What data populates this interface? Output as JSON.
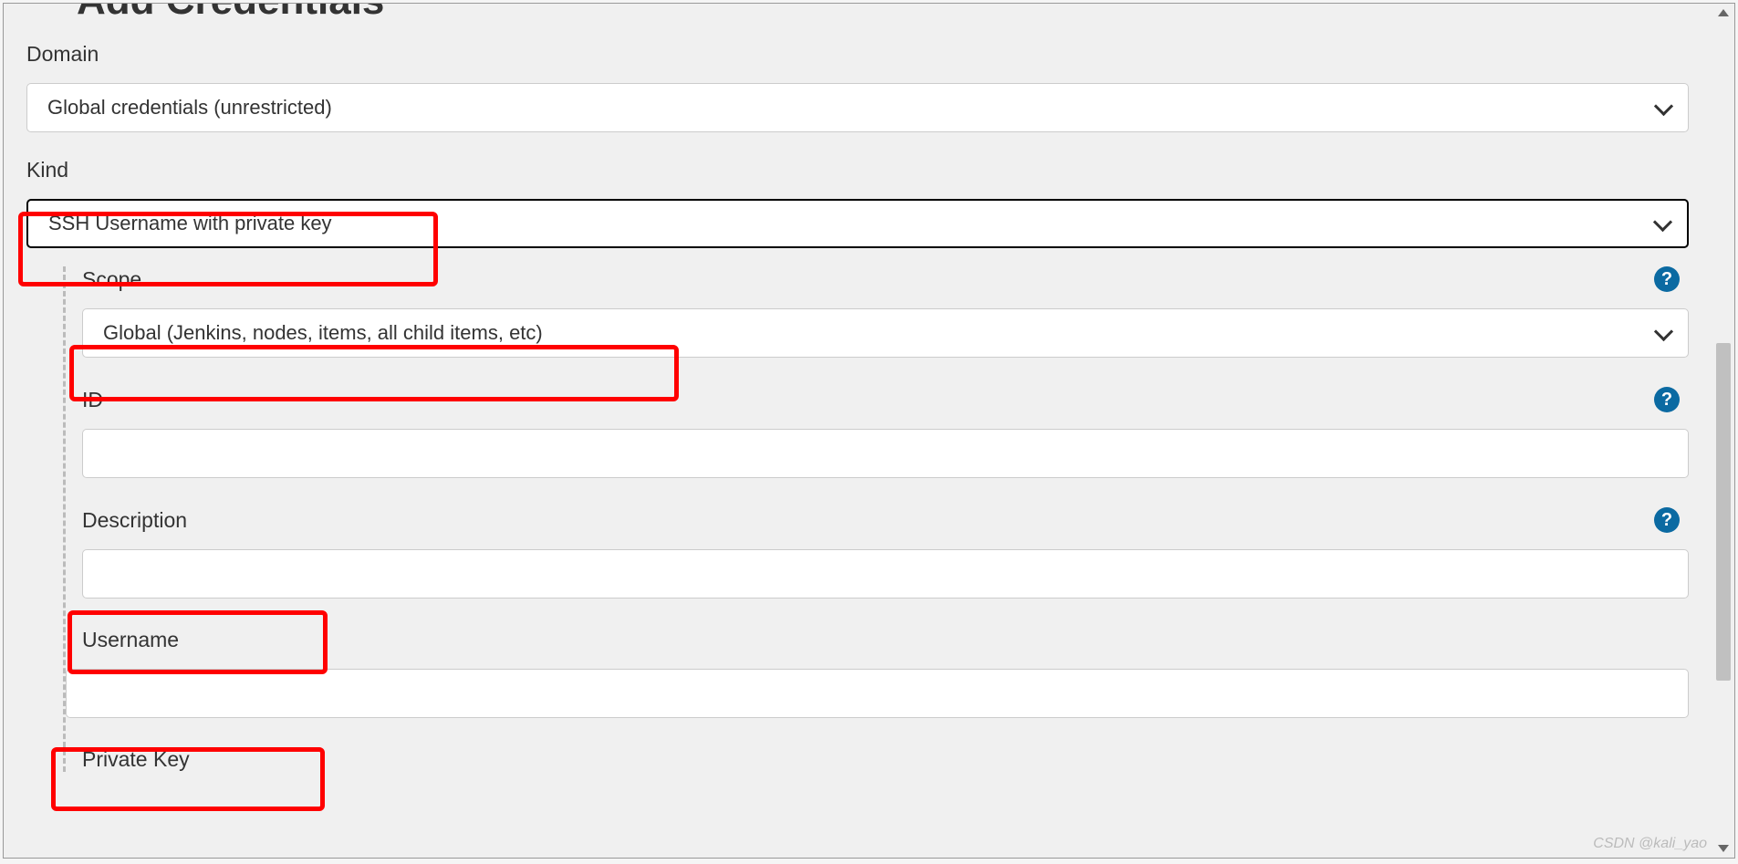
{
  "page": {
    "title": "Add Credentials"
  },
  "form": {
    "domain": {
      "label": "Domain",
      "value": "Global credentials (unrestricted)"
    },
    "kind": {
      "label": "Kind",
      "value": "SSH Username with private key"
    },
    "scope": {
      "label": "Scope",
      "value": "Global (Jenkins, nodes, items, all child items, etc)"
    },
    "id": {
      "label": "ID",
      "value": ""
    },
    "description": {
      "label": "Description",
      "value": ""
    },
    "username": {
      "label": "Username",
      "value": ""
    },
    "privateKey": {
      "label": "Private Key"
    }
  },
  "watermark": "CSDN @kali_yao",
  "helpTooltip": "?"
}
